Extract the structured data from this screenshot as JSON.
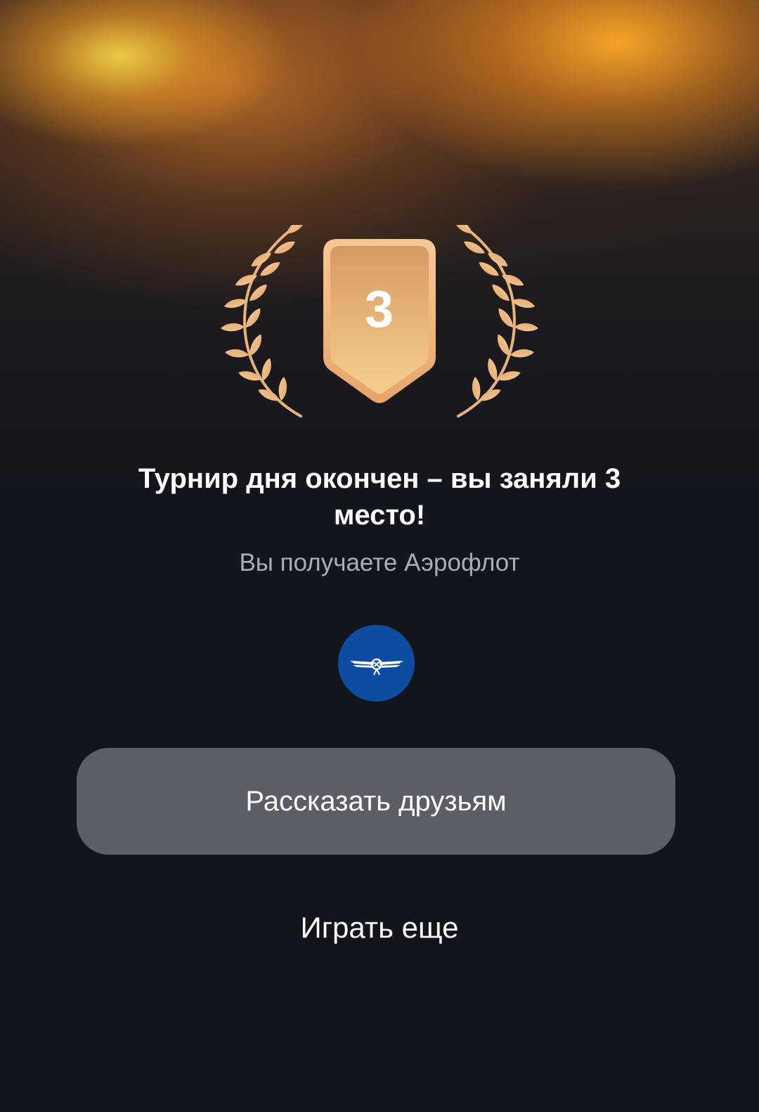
{
  "result": {
    "place_number": "3",
    "title": "Турнир дня окончен – вы заняли 3 место!",
    "subtitle": "Вы получаете Аэрофлот"
  },
  "partner": {
    "logo_icon": "aeroflot-wings-logo",
    "logo_color": "#0c4da2"
  },
  "actions": {
    "share_label": "Рассказать друзьям",
    "play_again_label": "Играть еще"
  },
  "colors": {
    "badge_gold": "#e8b27a",
    "button_bg": "#5b5e64",
    "page_bg": "#12151c"
  }
}
